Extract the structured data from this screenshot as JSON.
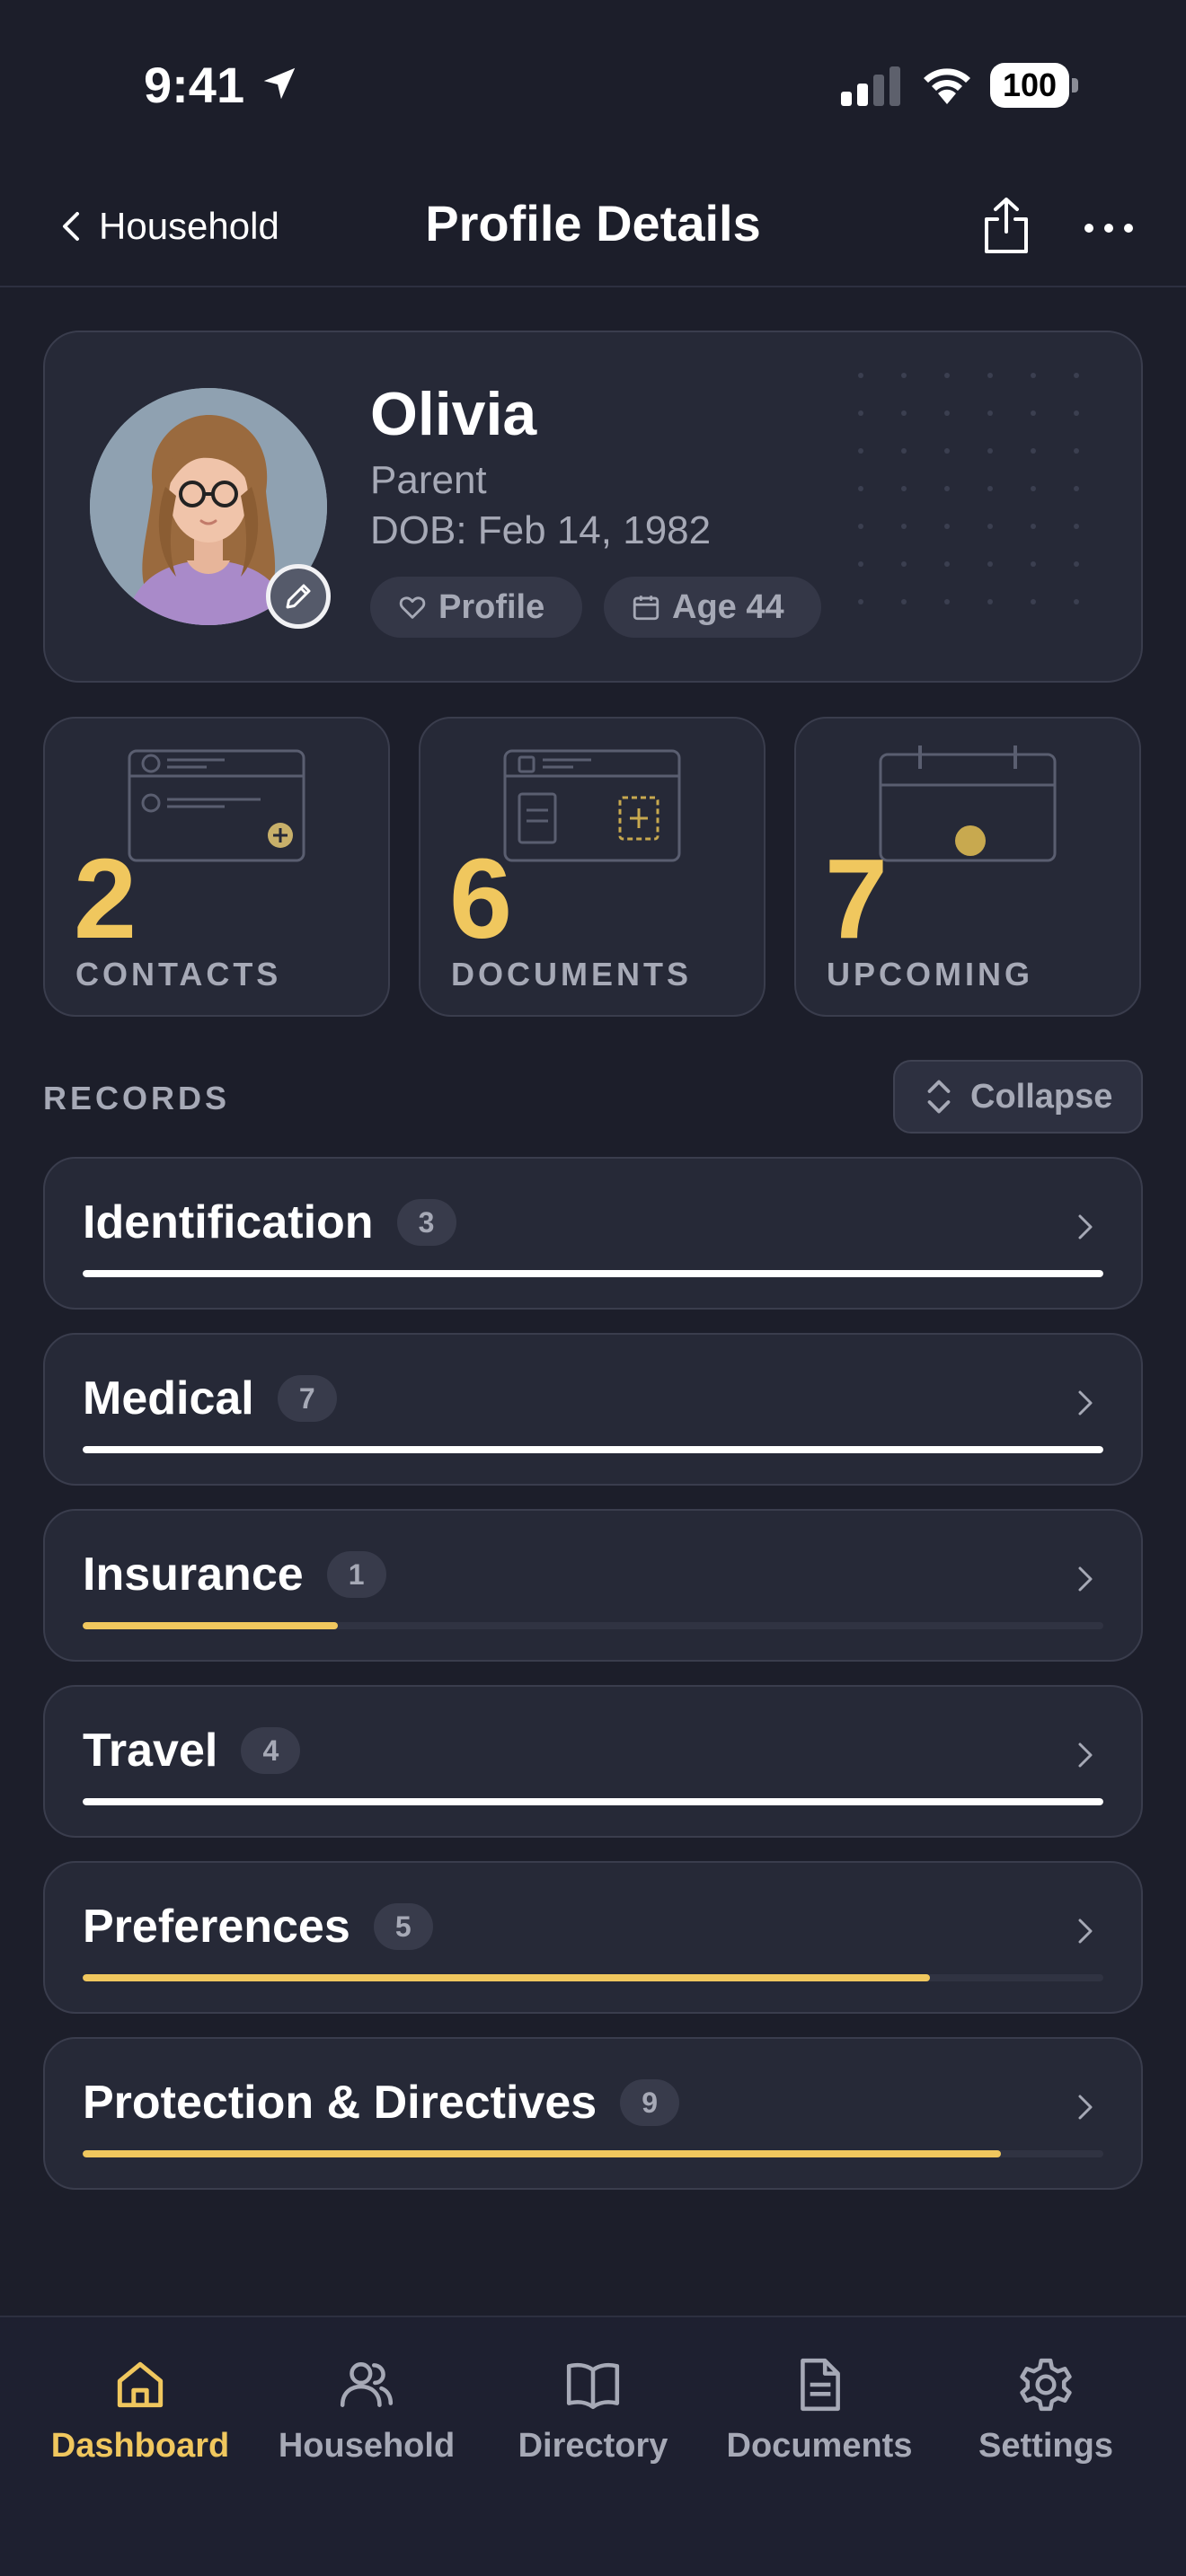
{
  "status_bar": {
    "time": "9:41",
    "battery": "100"
  },
  "nav": {
    "back_label": "Household",
    "title": "Profile Details",
    "icons": [
      "chevron-left-icon",
      "share-icon",
      "more-icon"
    ]
  },
  "profile": {
    "name": "Olivia",
    "role": "Parent",
    "dob": "DOB: Feb 14, 1982",
    "chips": [
      {
        "label": "Profile",
        "icon": "heart-icon"
      },
      {
        "label": "Age 44",
        "icon": "calendar-icon"
      }
    ]
  },
  "stats": [
    {
      "value": "2",
      "label": "CONTACTS"
    },
    {
      "value": "6",
      "label": "DOCUMENTS"
    },
    {
      "value": "7",
      "label": "UPCOMING"
    }
  ],
  "records_section": {
    "title": "RECORDS",
    "collapse_label": "Collapse"
  },
  "records": [
    {
      "title": "Identification",
      "count": "3",
      "progress": 1.0,
      "complete": true
    },
    {
      "title": "Medical",
      "count": "7",
      "progress": 1.0,
      "complete": true
    },
    {
      "title": "Insurance",
      "count": "1",
      "progress": 0.25,
      "complete": false
    },
    {
      "title": "Travel",
      "count": "4",
      "progress": 1.0,
      "complete": true
    },
    {
      "title": "Preferences",
      "count": "5",
      "progress": 0.83,
      "complete": false
    },
    {
      "title": "Protection & Directives",
      "count": "9",
      "progress": 0.9,
      "complete": false
    }
  ],
  "colors": {
    "accent": "#f0c75e",
    "complete": "#ffffff",
    "background": "#1c1e2a",
    "card": "#262937",
    "muted": "#a6a9b6"
  },
  "tabs": [
    {
      "label": "Dashboard",
      "icon": "home-icon",
      "active": true
    },
    {
      "label": "Household",
      "icon": "people-icon",
      "active": false
    },
    {
      "label": "Directory",
      "icon": "book-icon",
      "active": false
    },
    {
      "label": "Documents",
      "icon": "document-icon",
      "active": false
    },
    {
      "label": "Settings",
      "icon": "gear-icon",
      "active": false
    }
  ]
}
